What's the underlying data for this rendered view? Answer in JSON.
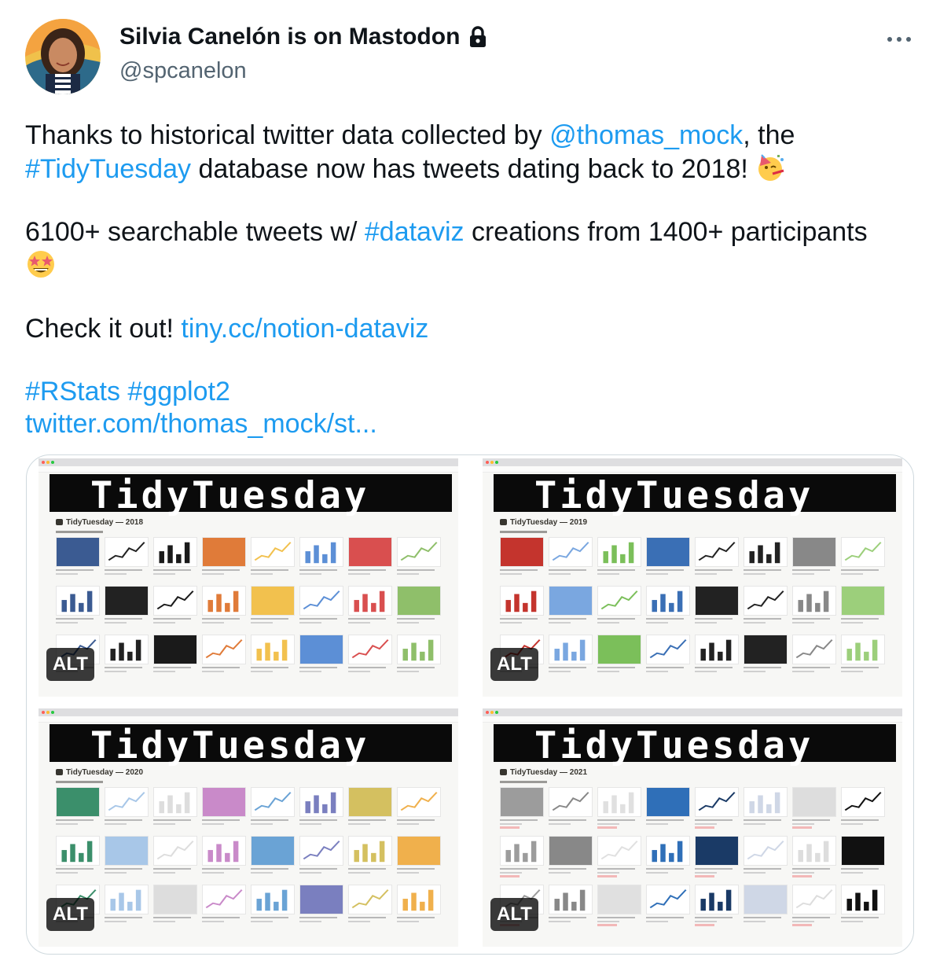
{
  "author": {
    "display_name": "Silvia Canelón is on Mastodon",
    "handle": "@spcanelon",
    "avatar_icon": "avatar-photo",
    "protected_icon": "lock-icon"
  },
  "menu": {
    "more_icon": "more-horizontal-icon"
  },
  "tweet": {
    "line1_pre": "Thanks to historical twitter data collected by ",
    "mention": "@thomas_mock",
    "line1_post": ", the",
    "hashtag_tidytuesday": "#TidyTuesday",
    "line2_post": " database now has tweets dating back to 2018! ",
    "emoji_party": "partying-face-emoji",
    "line3_pre": "6100+ searchable tweets w/ ",
    "hashtag_dataviz": "#dataviz",
    "line3_post": " creations from 1400+ participants",
    "emoji_stars": "star-struck-emoji",
    "line5_pre": "Check it out! ",
    "link": "tiny.cc/notion-dataviz",
    "hashtag_rstats": "#RStats",
    "hashtag_ggplot2": "#ggplot2",
    "quote_link": "twitter.com/thomas_mock/st..."
  },
  "media": [
    {
      "banner": "TidyTuesday",
      "section": "TidyTuesday — 2018",
      "alt": "ALT"
    },
    {
      "banner": "TidyTuesday",
      "section": "TidyTuesday — 2019",
      "alt": "ALT"
    },
    {
      "banner": "TidyTuesday",
      "section": "TidyTuesday — 2020",
      "alt": "ALT"
    },
    {
      "banner": "TidyTuesday",
      "section": "TidyTuesday — 2021",
      "alt": "ALT"
    }
  ],
  "colors": {
    "link": "#1d9bf0",
    "text": "#0f1419",
    "secondary": "#536471",
    "border": "#cfd9de"
  }
}
